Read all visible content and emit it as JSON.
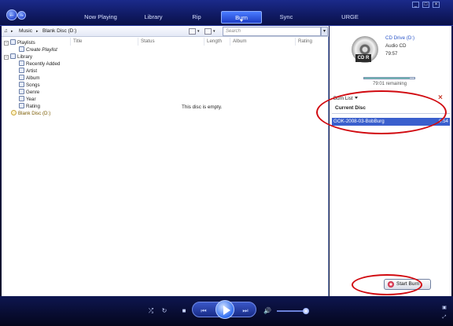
{
  "nav": {
    "tabs": [
      "Now Playing",
      "Library",
      "Rip",
      "Burn",
      "Sync",
      "URGE"
    ],
    "active_tab": "Burn"
  },
  "address": {
    "crumbs": [
      "Music",
      "Blank Disc (D:)"
    ],
    "search_placeholder": "Search"
  },
  "tree": {
    "items": [
      "Playlists",
      "Create Playlist",
      "Library",
      "Recently Added",
      "Artist",
      "Album",
      "Songs",
      "Genre",
      "Year",
      "Rating",
      "Blank Disc (D:)"
    ]
  },
  "grid": {
    "columns": [
      "Title",
      "Status",
      "Length",
      "Album",
      "Rating"
    ],
    "empty_message": "This disc is empty."
  },
  "side": {
    "drive_name": "CD Drive (D:)",
    "disc_type": "Audio CD",
    "time_remaining": "79:57",
    "remaining_label": "79:01 remaining",
    "progress_fraction": 0.9,
    "cd_label": "CD R",
    "burn_list_label": "Burn List",
    "current_disc_label": "Current Disc",
    "items": [
      {
        "name": "GOK-2008-03-BobBurg",
        "duration": "0:54"
      }
    ],
    "start_burn_label": "Start Burn"
  },
  "colors": {
    "accent": "#3a5fcd",
    "highlight_oval": "#d10a10"
  }
}
